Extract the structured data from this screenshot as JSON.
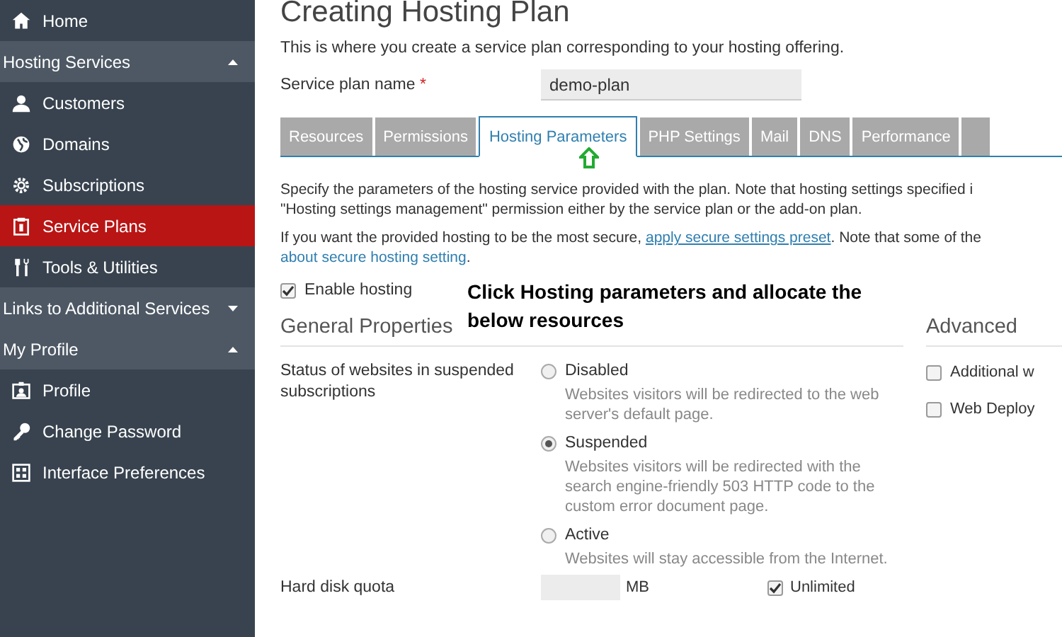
{
  "sidebar": [
    {
      "kind": "item",
      "label": "Home",
      "selected": false
    },
    {
      "kind": "section",
      "label": "Hosting Services",
      "expanded": true
    },
    {
      "kind": "item",
      "label": "Customers",
      "selected": false
    },
    {
      "kind": "item",
      "label": "Domains",
      "selected": false
    },
    {
      "kind": "item",
      "label": "Subscriptions",
      "selected": false
    },
    {
      "kind": "item",
      "label": "Service Plans",
      "selected": true
    },
    {
      "kind": "item",
      "label": "Tools & Utilities",
      "selected": false
    },
    {
      "kind": "section",
      "label": "Links to Additional Services",
      "expanded": false
    },
    {
      "kind": "section",
      "label": "My Profile",
      "expanded": true
    },
    {
      "kind": "item",
      "label": "Profile",
      "selected": false
    },
    {
      "kind": "item",
      "label": "Change Password",
      "selected": false
    },
    {
      "kind": "item",
      "label": "Interface Preferences",
      "selected": false
    }
  ],
  "title": "Creating Hosting Plan",
  "description": "This is where you create a service plan corresponding to your hosting offering.",
  "plan_name": {
    "label": "Service plan name",
    "required_mark": "*",
    "value": "demo-plan"
  },
  "tabs": [
    {
      "label": "Resources",
      "selected": false
    },
    {
      "label": "Permissions",
      "selected": false
    },
    {
      "label": "Hosting Parameters",
      "selected": true
    },
    {
      "label": "PHP Settings",
      "selected": false
    },
    {
      "label": "Mail",
      "selected": false
    },
    {
      "label": "DNS",
      "selected": false
    },
    {
      "label": "Performance",
      "selected": false
    }
  ],
  "intro": [
    "Specify the parameters of the hosting service provided with the plan. Note that hosting settings specified i",
    "\"Hosting settings management\" permission either by the service plan or the add-on plan."
  ],
  "secure_note": {
    "before": "If you want the provided hosting to be the most secure, ",
    "link": "apply secure settings preset",
    "after": ". Note that some of the",
    "link2": "about secure hosting setting",
    "end": "."
  },
  "enable_hosting": {
    "label": "Enable hosting",
    "checked": true
  },
  "annotation": "Click Hosting parameters and allocate the below resources",
  "general": {
    "heading": "General Properties",
    "status_label": "Status of websites in suspended subscriptions",
    "options": [
      {
        "label": "Disabled",
        "description": "Websites visitors will be redirected to the web server's default page.",
        "selected": false
      },
      {
        "label": "Suspended",
        "description": "Websites visitors will be redirected with the search engine-friendly 503 HTTP code to the custom error document page.",
        "selected": true
      },
      {
        "label": "Active",
        "description": "Websites will stay accessible from the Internet.",
        "selected": false
      }
    ],
    "quota": {
      "label": "Hard disk quota",
      "unit": "MB",
      "unlimited": {
        "label": "Unlimited",
        "checked": true
      }
    }
  },
  "advanced": {
    "heading": "Advanced",
    "options": [
      {
        "label": "Additional w",
        "checked": false
      },
      {
        "label": "Web Deploy",
        "checked": false
      }
    ]
  }
}
